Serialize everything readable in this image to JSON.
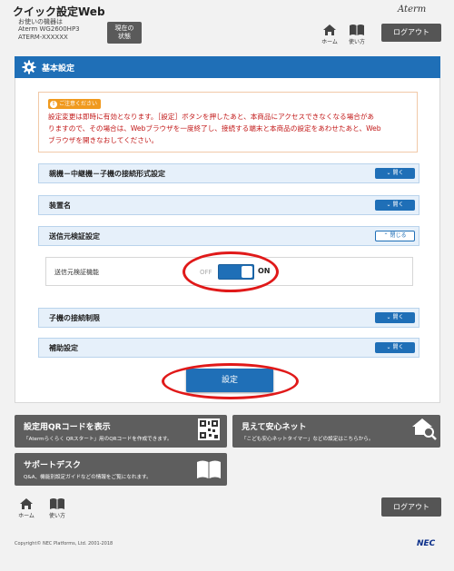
{
  "header": {
    "title": "クイック設定Web",
    "device_lines": [
      "お使いの機器は",
      "Aterm WG2600HP3",
      "ATERM-XXXXXX"
    ],
    "status_button": [
      "現在の",
      "状態"
    ],
    "brand": "Aterm",
    "home_label": "ホーム",
    "help_label": "使い方",
    "logout_label": "ログアウト"
  },
  "panel": {
    "title": "基本設定",
    "notice": {
      "badge": "ご注意ください",
      "lines": [
        "設定変更は即時に有効となります。［設定］ボタンを押したあと、本商品にアクセスできなくなる場合があ",
        "りますので、その場合は、Webブラウザを一度終了し、接続する端末と本商品の設定をあわせたあと、Web",
        "ブラウザを開きなおしてください。"
      ]
    },
    "sections": [
      {
        "label": "親機－中継機－子機の接続形式設定",
        "button": "開く"
      },
      {
        "label": "装置名",
        "button": "開く"
      },
      {
        "label": "送信元検証設定",
        "button": "閉じる"
      },
      {
        "label": "子機の接続制限",
        "button": "開く"
      },
      {
        "label": "補助設定",
        "button": "開く"
      }
    ],
    "source_check": {
      "label": "送信元検証機能",
      "off": "OFF",
      "on": "ON",
      "value": "ON"
    },
    "submit_label": "設定"
  },
  "tiles": [
    {
      "title": "設定用QRコードを表示",
      "desc": "「Atermらくらく QRスタート」用のQRコードを作成できます。",
      "icon": "qr-code-icon"
    },
    {
      "title": "見えて安心ネット",
      "desc": "「こども安心ネットタイマー」などの設定はこちらから。",
      "icon": "home-search-icon"
    },
    {
      "title": "サポートデスク",
      "desc": "Q&A、機能別設定ガイドなどの情報をご覧になれます。",
      "icon": "book-icon"
    }
  ],
  "footer": {
    "home_label": "ホーム",
    "help_label": "使い方",
    "logout_label": "ログアウト",
    "copyright": "Copyright© NEC Platforms, Ltd. 2001-2018",
    "logo": "NEC"
  },
  "colors": {
    "accent": "#1f6fb7",
    "warning": "#c21818",
    "badge": "#f09a1f",
    "tile": "#5e5e5e",
    "highlight_ring": "#e01919"
  }
}
